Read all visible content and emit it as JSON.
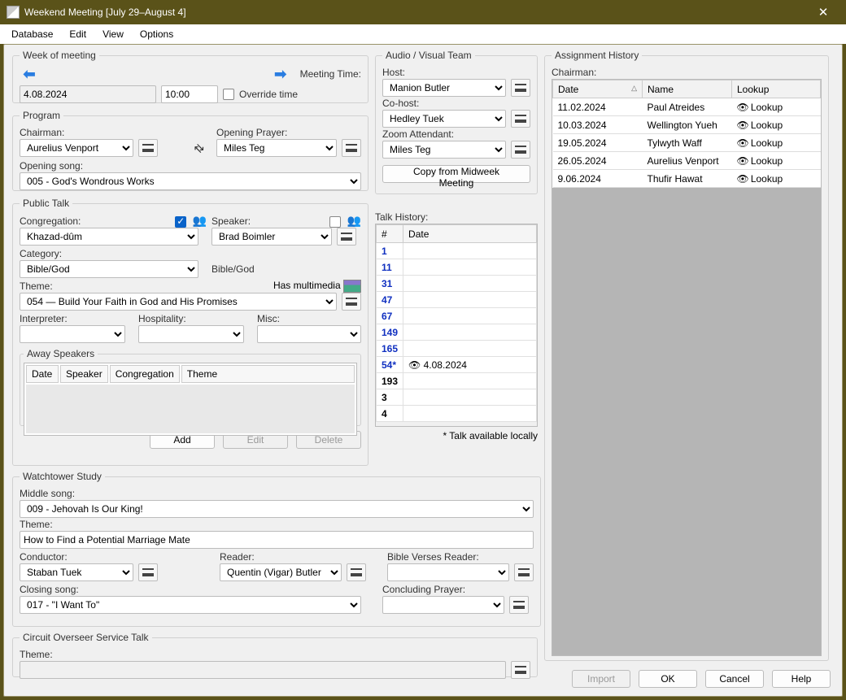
{
  "window": {
    "title": "Weekend Meeting [July 29–August 4]"
  },
  "menu": {
    "database": "Database",
    "edit": "Edit",
    "view": "View",
    "options": "Options"
  },
  "week": {
    "legend": "Week of meeting",
    "date": "4.08.2024",
    "meeting_time_label": "Meeting Time:",
    "time": "10:00",
    "override": "Override time"
  },
  "program": {
    "legend": "Program",
    "chairman_label": "Chairman:",
    "chairman": "Aurelius Venport",
    "opening_prayer_label": "Opening Prayer:",
    "opening_prayer": "Miles Teg",
    "opening_song_label": "Opening song:",
    "opening_song": "005 - God's Wondrous Works"
  },
  "av": {
    "legend": "Audio / Visual Team",
    "host_label": "Host:",
    "host": "Manion Butler",
    "cohost_label": "Co-host:",
    "cohost": "Hedley Tuek",
    "zoom_label": "Zoom Attendant:",
    "zoom": "Miles Teg",
    "copy_btn": "Copy from Midweek Meeting"
  },
  "public_talk": {
    "legend": "Public Talk",
    "congregation_label": "Congregation:",
    "congregation": "Khazad-dûm",
    "speaker_label": "Speaker:",
    "speaker": "Brad Boimler",
    "category_label": "Category:",
    "category": "Bible/God",
    "category_echo": "Bible/God",
    "theme_label": "Theme:",
    "multimedia_label": "Has multimedia",
    "theme": "054 — Build Your Faith in God and His Promises",
    "interpreter_label": "Interpreter:",
    "hospitality_label": "Hospitality:",
    "misc_label": "Misc:",
    "away_legend": "Away Speakers",
    "away_headers": {
      "date": "Date",
      "speaker": "Speaker",
      "congregation": "Congregation",
      "theme": "Theme"
    },
    "add_btn": "Add",
    "edit_btn": "Edit",
    "delete_btn": "Delete"
  },
  "talk_history": {
    "label": "Talk History:",
    "col_num": "#",
    "col_date": "Date",
    "rows": [
      {
        "n": "1",
        "blue": true,
        "date": ""
      },
      {
        "n": "11",
        "blue": true,
        "date": ""
      },
      {
        "n": "31",
        "blue": true,
        "date": ""
      },
      {
        "n": "47",
        "blue": true,
        "date": ""
      },
      {
        "n": "67",
        "blue": true,
        "date": ""
      },
      {
        "n": "149",
        "blue": true,
        "date": ""
      },
      {
        "n": "165",
        "blue": true,
        "date": ""
      },
      {
        "n": "54*",
        "blue": true,
        "date": "👁 4.08.2024"
      },
      {
        "n": "193",
        "blue": false,
        "date": ""
      },
      {
        "n": "3",
        "blue": false,
        "date": ""
      },
      {
        "n": "4",
        "blue": false,
        "date": ""
      }
    ],
    "footnote": "* Talk available locally"
  },
  "wt": {
    "legend": "Watchtower Study",
    "middle_song_label": "Middle song:",
    "middle_song": "009 - Jehovah Is Our King!",
    "theme_label": "Theme:",
    "theme": "How to Find a Potential Marriage Mate",
    "conductor_label": "Conductor:",
    "conductor": "Staban Tuek",
    "reader_label": "Reader:",
    "reader": "Quentin (Vigar) Butler",
    "bvr_label": "Bible Verses Reader:",
    "closing_song_label": "Closing song:",
    "closing_song": "017 - \"I Want To\"",
    "concluding_prayer_label": "Concluding Prayer:"
  },
  "co": {
    "legend": "Circuit Overseer Service Talk",
    "theme_label": "Theme:"
  },
  "assignment_history": {
    "legend": "Assignment History",
    "subject": "Chairman:",
    "col_date": "Date",
    "col_name": "Name",
    "col_lookup": "Lookup",
    "lookup_word": "Lookup",
    "rows": [
      {
        "date": "11.02.2024",
        "name": "Paul Atreides"
      },
      {
        "date": "10.03.2024",
        "name": "Wellington Yueh"
      },
      {
        "date": "19.05.2024",
        "name": "Tylwyth Waff"
      },
      {
        "date": "26.05.2024",
        "name": "Aurelius Venport"
      },
      {
        "date": "9.06.2024",
        "name": "Thufir Hawat"
      }
    ]
  },
  "footer": {
    "import": "Import",
    "ok": "OK",
    "cancel": "Cancel",
    "help": "Help"
  }
}
